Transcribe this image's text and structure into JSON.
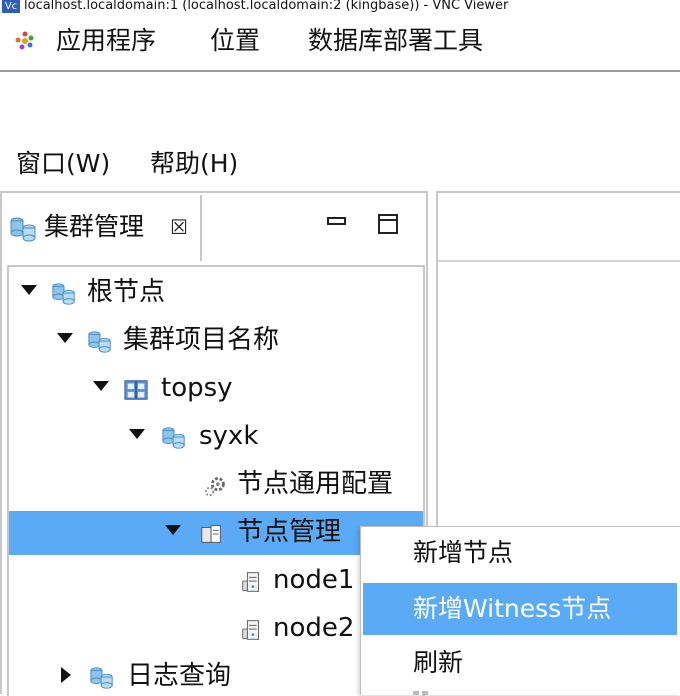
{
  "vnc": {
    "logo_text": "Vc",
    "title": "localhost.localdomain:1 (localhost.localdomain:2 (kingbase)) - VNC Viewer"
  },
  "gnome_bar": {
    "applications": "应用程序",
    "places": "位置",
    "db_deploy_tool": "数据库部署工具"
  },
  "menu": {
    "window": "窗口(W)",
    "help": "帮助(H)"
  },
  "view": {
    "tab_title": "集群管理",
    "close_glyph": "☒"
  },
  "tree": {
    "root": "根节点",
    "cluster_project": "集群项目名称",
    "topsy": "topsy",
    "syxk": "syxk",
    "node_common_config": "节点通用配置",
    "node_management": "节点管理",
    "node1": "node1",
    "node2": "node2",
    "log_query": "日志查询"
  },
  "context_menu": {
    "add_node": "新增节点",
    "add_witness_node": "新增Witness节点",
    "refresh": "刷新"
  },
  "colors": {
    "selection": "#5aaaf5",
    "db_icon": "#8ec3ea",
    "panel_border": "#c8c8c8"
  }
}
